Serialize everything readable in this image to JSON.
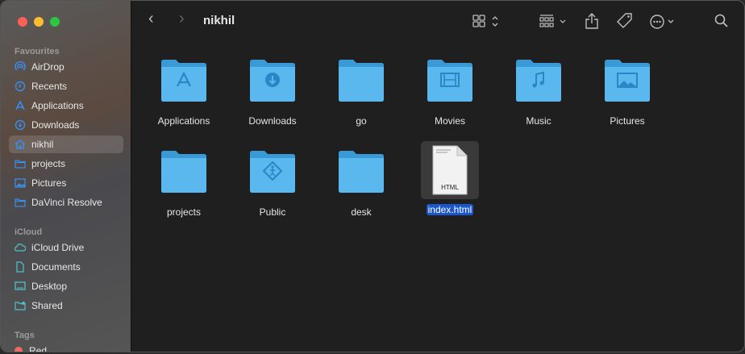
{
  "window": {
    "title": "nikhil"
  },
  "sidebar": {
    "favourites_label": "Favourites",
    "favourites": [
      {
        "label": "AirDrop",
        "icon": "airdrop-icon"
      },
      {
        "label": "Recents",
        "icon": "clock-icon"
      },
      {
        "label": "Applications",
        "icon": "applications-icon"
      },
      {
        "label": "Downloads",
        "icon": "download-icon"
      },
      {
        "label": "nikhil",
        "icon": "home-icon",
        "selected": true
      },
      {
        "label": "projects",
        "icon": "folder-icon"
      },
      {
        "label": "Pictures",
        "icon": "pictures-icon"
      },
      {
        "label": "DaVinci Resolve",
        "icon": "folder-icon"
      }
    ],
    "icloud_label": "iCloud",
    "icloud": [
      {
        "label": "iCloud Drive",
        "icon": "cloud-icon"
      },
      {
        "label": "Documents",
        "icon": "document-icon"
      },
      {
        "label": "Desktop",
        "icon": "desktop-icon"
      },
      {
        "label": "Shared",
        "icon": "shared-folder-icon"
      }
    ],
    "tags_label": "Tags",
    "tags": [
      {
        "label": "Red",
        "color": "#f06a5f"
      }
    ]
  },
  "files": [
    {
      "name": "Applications",
      "glyph": "app-store-icon"
    },
    {
      "name": "Downloads",
      "glyph": "download-icon"
    },
    {
      "name": "go",
      "glyph": ""
    },
    {
      "name": "Movies",
      "glyph": "film-icon"
    },
    {
      "name": "Music",
      "glyph": "music-note-icon"
    },
    {
      "name": "Pictures",
      "glyph": "picture-icon"
    },
    {
      "name": "projects",
      "glyph": ""
    },
    {
      "name": "Public",
      "glyph": "public-icon"
    },
    {
      "name": "desk",
      "glyph": ""
    },
    {
      "name": "index.html",
      "type": "HTML",
      "selected": true
    }
  ],
  "colors": {
    "folder": "#5ab8ee",
    "folder_dark": "#3a9ad6",
    "selection": "#1a56c8"
  }
}
